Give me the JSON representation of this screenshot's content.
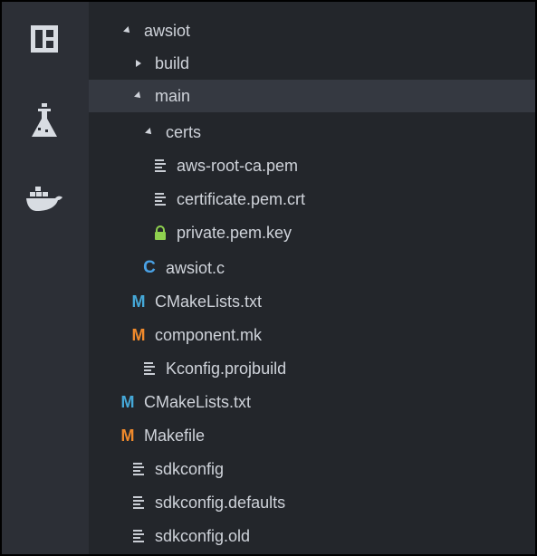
{
  "activity_bar": {
    "items": [
      {
        "icon": "explorer-icon"
      },
      {
        "icon": "flask-icon"
      },
      {
        "icon": "docker-icon"
      }
    ]
  },
  "tree": {
    "items": [
      {
        "label": "awsiot",
        "icon": "twisty-down-icon"
      },
      {
        "label": "build",
        "icon": "twisty-right-icon"
      },
      {
        "label": "main",
        "icon": "twisty-down-icon",
        "selected": true
      },
      {
        "label": "certs",
        "icon": "twisty-down-icon"
      },
      {
        "label": "aws-root-ca.pem",
        "icon": "file-lines-icon"
      },
      {
        "label": "certificate.pem.crt",
        "icon": "file-lines-icon"
      },
      {
        "label": "private.pem.key",
        "icon": "lock-icon"
      },
      {
        "label": "awsiot.c",
        "icon": "c-file-icon"
      },
      {
        "label": "CMakeLists.txt",
        "icon": "cmake-file-icon"
      },
      {
        "label": "component.mk",
        "icon": "makefile-icon"
      },
      {
        "label": "Kconfig.projbuild",
        "icon": "file-lines-icon"
      },
      {
        "label": "CMakeLists.txt",
        "icon": "cmake-file-icon"
      },
      {
        "label": "Makefile",
        "icon": "makefile-icon"
      },
      {
        "label": "sdkconfig",
        "icon": "file-lines-icon"
      },
      {
        "label": "sdkconfig.defaults",
        "icon": "file-lines-icon"
      },
      {
        "label": "sdkconfig.old",
        "icon": "file-lines-icon"
      }
    ]
  },
  "colors": {
    "background": "#23262b",
    "activity_bar": "#2c2f36",
    "selection": "#353941",
    "text": "#cfd3da",
    "c_icon": "#4aa2e6",
    "cmake_icon": "#45a8d8",
    "make_icon": "#f08a2c",
    "lock_icon": "#8fd14f"
  },
  "glyphs": {
    "c": "C",
    "m": "M"
  }
}
